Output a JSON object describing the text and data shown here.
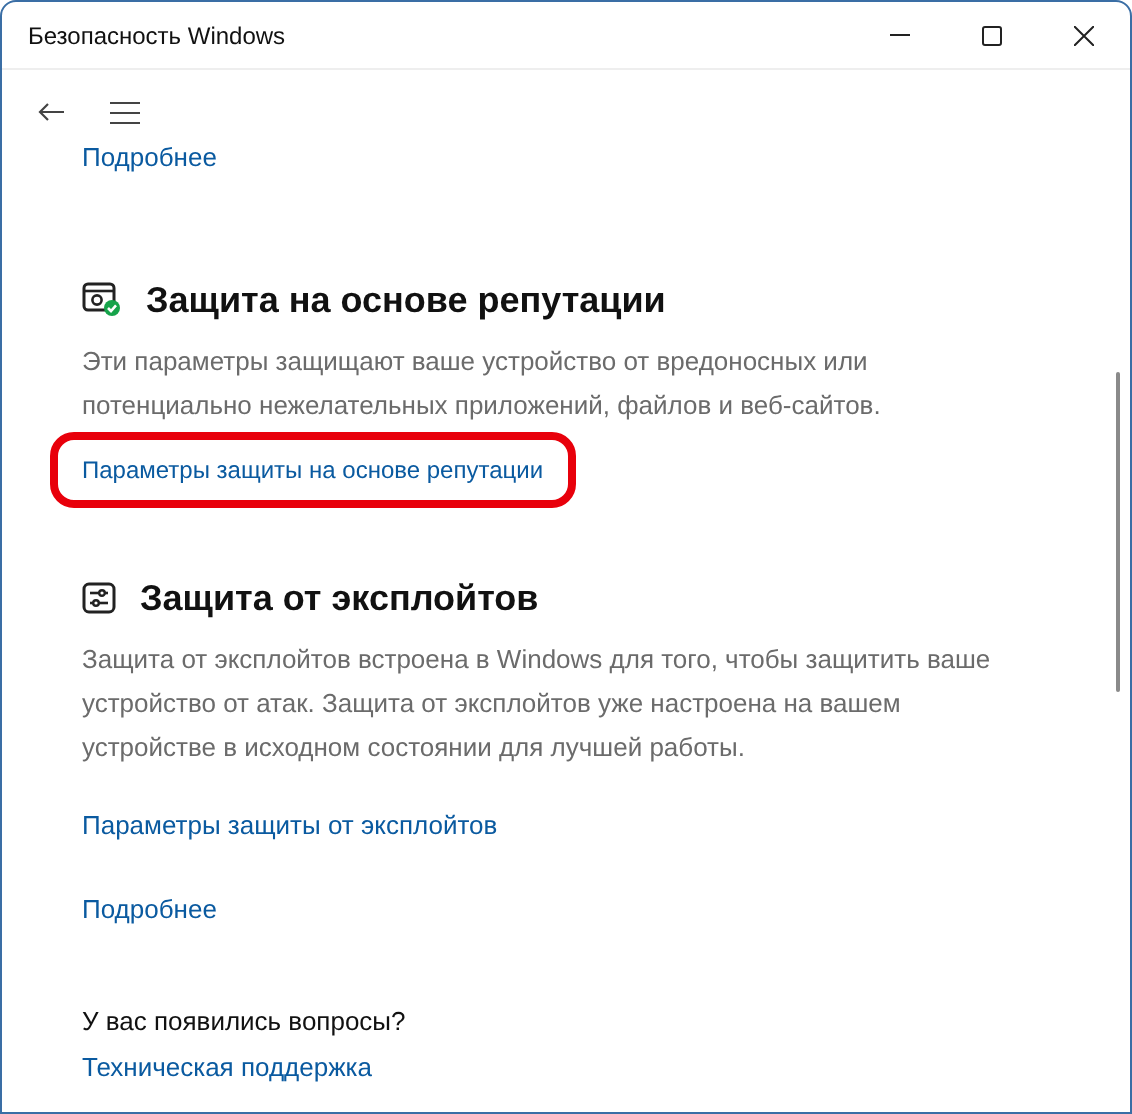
{
  "window": {
    "title": "Безопасность Windows"
  },
  "top_link": "Подробнее",
  "sections": [
    {
      "kind": "reputation",
      "heading": "Защита на основе репутации",
      "description": "Эти параметры защищают ваше устройство от вредоносных или потенциально нежелательных приложений, файлов и веб-сайтов.",
      "links": [
        {
          "label": "Параметры защиты на основе репутации",
          "highlighted": true
        }
      ]
    },
    {
      "kind": "exploit",
      "heading": "Защита от эксплойтов",
      "description": "Защита от эксплойтов встроена в Windows для того, чтобы защитить ваше устройство от атак.  Защита от эксплойтов уже настроена на вашем устройстве в исходном состоянии для лучшей работы.",
      "links": [
        {
          "label": "Параметры защиты от эксплойтов",
          "highlighted": false
        },
        {
          "label": "Подробнее",
          "highlighted": false
        }
      ]
    }
  ],
  "questions": {
    "heading": "У вас появились вопросы?",
    "link": "Техническая поддержка"
  }
}
